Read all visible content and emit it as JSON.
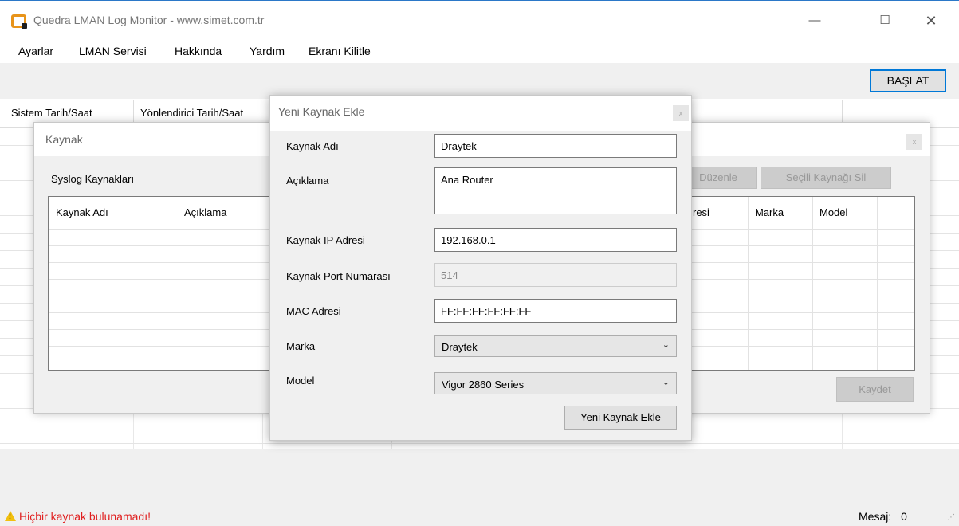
{
  "window": {
    "title": "Quedra LMAN Log Monitor - www.simet.com.tr",
    "controls": {
      "minimize": "—",
      "maximize": "☐",
      "close": "✕"
    }
  },
  "menu": {
    "items": [
      "Ayarlar",
      "LMAN Servisi",
      "Hakkında",
      "Yardım",
      "Ekranı Kilitle"
    ]
  },
  "toolbar": {
    "start_label": "BAŞLAT"
  },
  "main_grid": {
    "columns": [
      "Sistem Tarih/Saat",
      "Yönlendirici Tarih/Saat"
    ]
  },
  "status": {
    "warning_text": "Hiçbir kaynak bulunamadı!",
    "message_label": "Mesaj:",
    "message_count": "0"
  },
  "kaynak_dialog": {
    "title": "Kaynak",
    "close": "x",
    "group_label": "Syslog Kaynakları",
    "columns": [
      "Kaynak Adı",
      "Açıklama",
      "resi",
      "Marka",
      "Model"
    ],
    "edit_button": "Düzenle",
    "delete_button": "Seçili Kaynağı Sil",
    "save_button": "Kaydet"
  },
  "add_dialog": {
    "title": "Yeni Kaynak Ekle",
    "close": "x",
    "fields": {
      "name_label": "Kaynak Adı",
      "name_value": "Draytek",
      "desc_label": "Açıklama",
      "desc_value": "Ana Router",
      "ip_label": "Kaynak IP Adresi",
      "ip_value": "192.168.0.1",
      "port_label": "Kaynak Port Numarası",
      "port_value": "514",
      "mac_label": "MAC Adresi",
      "mac_value": "FF:FF:FF:FF:FF:FF",
      "brand_label": "Marka",
      "brand_value": "Draytek",
      "model_label": "Model",
      "model_value": "Vigor 2860 Series"
    },
    "submit_button": "Yeni Kaynak Ekle"
  },
  "icons": {
    "app": "app-icon",
    "warning": "warning-icon",
    "chevron": "chevron-down-icon",
    "grip": "resize-grip-icon"
  }
}
